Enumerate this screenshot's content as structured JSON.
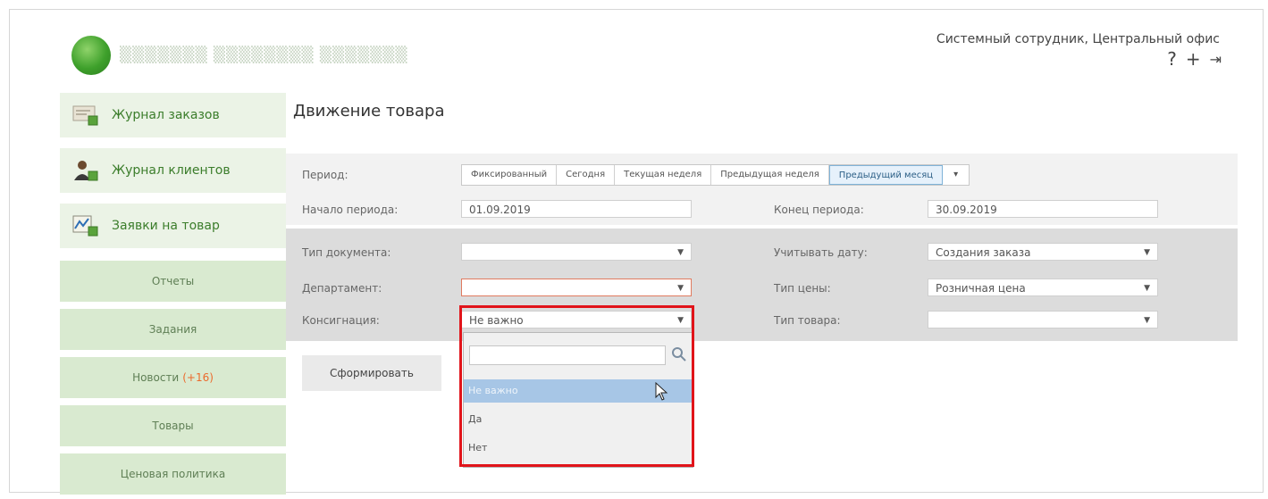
{
  "header": {
    "user_info": "Системный сотрудник, Центральный офис",
    "icons": [
      "help-icon",
      "plus-icon",
      "logout-icon"
    ],
    "help_glyph": "?",
    "plus_glyph": "+",
    "logout_glyph": "⇥"
  },
  "sidebar": {
    "big_items": [
      {
        "label": "Журнал заказов",
        "icon": "orders-journal-icon"
      },
      {
        "label": "Журнал клиентов",
        "icon": "clients-journal-icon"
      },
      {
        "label": "Заявки на товар",
        "icon": "product-requests-icon"
      }
    ],
    "buttons": [
      {
        "label": "Отчеты"
      },
      {
        "label": "Задания"
      },
      {
        "label": "Новости",
        "badge": "(+16)"
      },
      {
        "label": "Товары"
      },
      {
        "label": "Ценовая политика"
      }
    ]
  },
  "main": {
    "title": "Движение товара",
    "period_label": "Период:",
    "period_tabs": [
      "Фиксированный",
      "Сегодня",
      "Текущая неделя",
      "Предыдущая неделя",
      "Предыдущий месяц"
    ],
    "period_active": "Предыдущий месяц",
    "start_label": "Начало периода:",
    "start_value": "01.09.2019",
    "end_label": "Конец периода:",
    "end_value": "30.09.2019",
    "doc_type_label": "Тип документа:",
    "doc_type_value": "",
    "department_label": "Департамент:",
    "department_value": "",
    "consignment_label": "Консигнация:",
    "consignment_value": "Не важно",
    "date_basis_label": "Учитывать дату:",
    "date_basis_value": "Создания заказа",
    "price_type_label": "Тип цены:",
    "price_type_value": "Розничная цена",
    "product_type_label": "Тип товара:",
    "product_type_value": "",
    "generate_label": "Сформировать"
  },
  "dropdown": {
    "search_value": "",
    "options": [
      "Не важно",
      "Да",
      "Нет"
    ],
    "selected": "Не важно"
  },
  "colors": {
    "accent_green": "#3b7d2b",
    "sidebar_button": "#d9ead0",
    "highlight_red": "#e1141a",
    "selected_option": "#a7c6e6"
  }
}
